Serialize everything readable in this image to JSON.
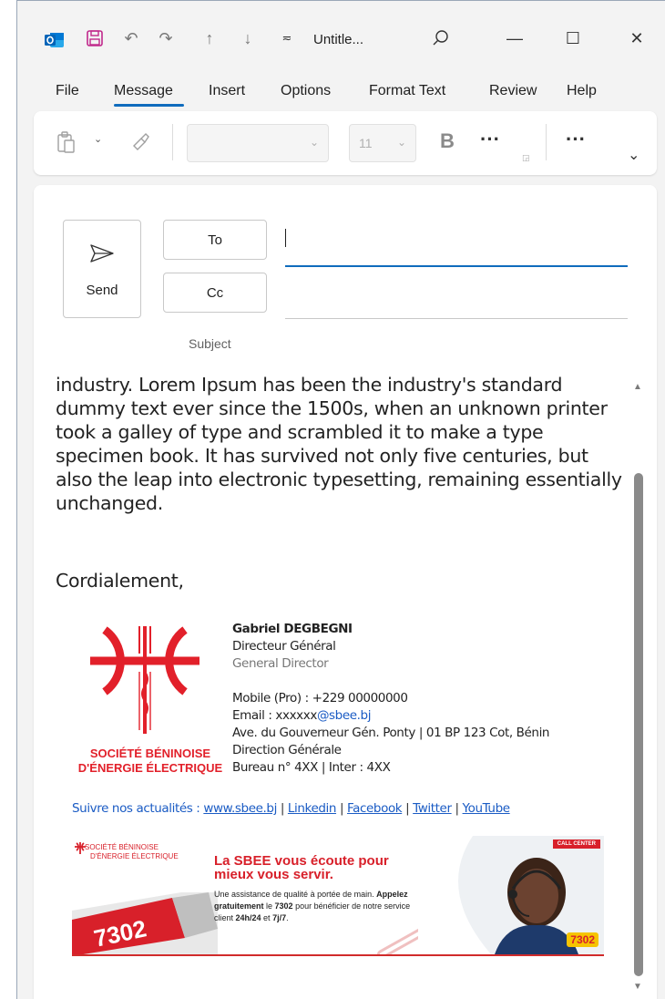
{
  "window": {
    "title": "Untitle...",
    "quick_access": [
      "outlook-icon",
      "save-icon",
      "undo-icon",
      "redo-icon",
      "up-arrow-icon",
      "down-arrow-icon",
      "customize-icon"
    ],
    "controls": [
      "search-icon",
      "minimize-icon",
      "maximize-icon",
      "close-icon"
    ]
  },
  "menu": {
    "file": "File",
    "message": "Message",
    "insert": "Insert",
    "options": "Options",
    "format_text": "Format Text",
    "review": "Review",
    "help": "Help",
    "active": "Message"
  },
  "ribbon": {
    "font_name": "",
    "font_size": "11",
    "bold": "B",
    "more1": "···",
    "more2": "···"
  },
  "compose": {
    "send_label": "Send",
    "to_label": "To",
    "cc_label": "Cc",
    "subject_label": "Subject",
    "to_value": "",
    "cc_value": ""
  },
  "body": {
    "paragraph": "industry. Lorem Ipsum has been the industry's standard dummy text ever since the 1500s, when an unknown printer took a galley of type and scrambled it to make a type specimen book. It has survived not only five centuries, but also the leap into electronic typesetting, remaining essentially unchanged.",
    "closing": "Cordialement,"
  },
  "signature": {
    "logo_line1": "SOCIÉTÉ BÉNINOISE",
    "logo_line2": "D'ÉNERGIE ÉLECTRIQUE",
    "name": "Gabriel DEGBEGNI",
    "title_fr": "Directeur Général",
    "title_en": "General Director",
    "mobile": "Mobile (Pro) : +229 00000000",
    "email_prefix": "Email : ",
    "email_user": "xxxxxx",
    "email_domain": "@sbee.bj",
    "address": "Ave. du Gouverneur Gén. Ponty | 01 BP 123 Cot, Bénin",
    "direction": "Direction Générale",
    "bureau": "Bureau n° 4XX  | Inter : 4XX",
    "follow_label": "Suivre nos actualités : ",
    "links": {
      "website": "www.sbee.bj",
      "linkedin": "Linkedin",
      "facebook": "Facebook",
      "twitter": "Twitter",
      "youtube": "YouTube"
    },
    "separator": " | "
  },
  "banner": {
    "logo_line1": "SOCIÉTÉ BÉNINOISE",
    "logo_line2": "D'ÉNERGIE ÉLECTRIQUE",
    "headline1": "La SBEE vous écoute pour",
    "headline2": "mieux vous servir.",
    "desc1": "Une assistance de qualité à portée de main.",
    "desc_bold1": "Appelez gratuitement",
    "desc2": " le ",
    "desc_bold2": "7302",
    "desc3": " pour bénéficier de notre service client ",
    "desc_bold3": "24h/24",
    "desc4": " et ",
    "desc_bold4": "7j/7",
    "desc5": ".",
    "number": "7302",
    "call_center": "CALL CENTER",
    "badge": "7302"
  },
  "colors": {
    "accent": "#0f6cbd",
    "brand_red": "#e2202a",
    "link_blue": "#1a5bc4"
  }
}
